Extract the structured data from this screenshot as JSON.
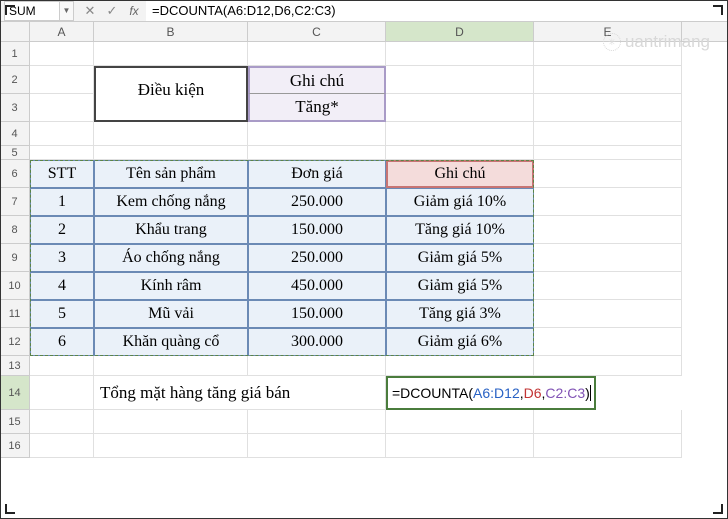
{
  "name_box": "SUM",
  "formula_bar": "=DCOUNTA(A6:D12,D6,C2:C3)",
  "columns": [
    "A",
    "B",
    "C",
    "D",
    "E"
  ],
  "rows": [
    "1",
    "2",
    "3",
    "4",
    "5",
    "6",
    "7",
    "8",
    "9",
    "10",
    "11",
    "12",
    "13",
    "14",
    "15",
    "16"
  ],
  "criteria": {
    "label": "Điều kiện",
    "header": "Ghi chú",
    "value": "Tăng*"
  },
  "table": {
    "headers": [
      "STT",
      "Tên sản phẩm",
      "Đơn giá",
      "Ghi chú"
    ],
    "rows": [
      [
        "1",
        "Kem chống nắng",
        "250.000",
        "Giảm giá 10%"
      ],
      [
        "2",
        "Khẩu trang",
        "150.000",
        "Tăng giá 10%"
      ],
      [
        "3",
        "Áo chống nắng",
        "250.000",
        "Giảm giá 5%"
      ],
      [
        "4",
        "Kính râm",
        "450.000",
        "Giảm giá 5%"
      ],
      [
        "5",
        "Mũ vải",
        "150.000",
        "Tăng giá 3%"
      ],
      [
        "6",
        "Khăn quàng cổ",
        "300.000",
        "Giảm giá 6%"
      ]
    ]
  },
  "summary_label": "Tổng mặt hàng tăng giá bán",
  "formula_cell": {
    "prefix": "=DCOUNTA(",
    "arg1": "A6:D12",
    "sep": ",",
    "arg2": "D6",
    "arg3": "C2:C3",
    "suffix": ")"
  },
  "watermark": "uantrimang",
  "watermark_gear": "✳"
}
